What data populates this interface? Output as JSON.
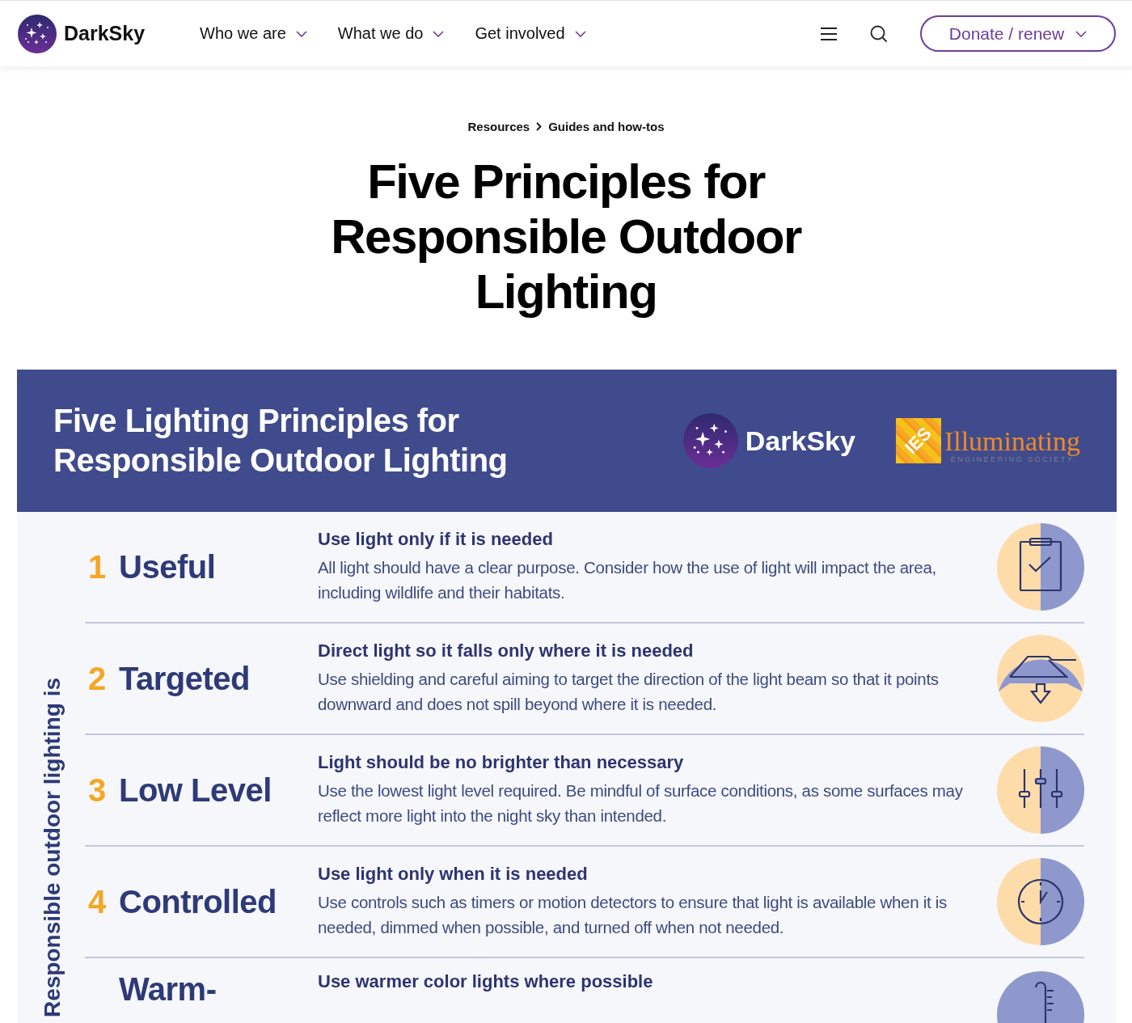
{
  "header": {
    "logo": "DarkSky",
    "nav": [
      {
        "label": "Who we are"
      },
      {
        "label": "What we do"
      },
      {
        "label": "Get involved"
      }
    ],
    "donate": "Donate / renew"
  },
  "breadcrumb": [
    "Resources",
    "Guides and how-tos"
  ],
  "title_lines": [
    "Five Principles for",
    "Responsible Outdoor",
    "Lighting"
  ],
  "banner": {
    "title_lines": [
      "Five Lighting Principles for",
      "Responsible Outdoor Lighting"
    ],
    "darksky": "DarkSky",
    "ies": {
      "mark": "IES",
      "name": "Illuminating",
      "sub": "ENGINEERING SOCIETY"
    }
  },
  "side_label": "Responsible outdoor lighting is",
  "principles": [
    {
      "number": "1",
      "name": "Useful",
      "heading": "Use light only if it is needed",
      "body": "All light should have a clear purpose. Consider how the use of light will impact the area, including wildlife and their habitats.",
      "icon": {
        "kind": "clipboard"
      }
    },
    {
      "number": "2",
      "name": "Targeted",
      "heading": "Direct light so it falls only where it is needed",
      "body": "Use shielding and careful aiming to target the direction of the light beam so that it points downward and does not spill beyond where it is needed.",
      "icon": {
        "kind": "fixture"
      }
    },
    {
      "number": "3",
      "name": "Low Level",
      "heading": "Light should be no brighter than necessary",
      "body": "Use the lowest light level required. Be mindful of surface conditions, as some surfaces may reflect more light into the night sky than intended.",
      "icon": {
        "kind": "sliders"
      }
    },
    {
      "number": "4",
      "name": "Controlled",
      "heading": "Use light only when it is needed",
      "body": "Use controls such as timers or motion detectors to ensure that light is available when it is needed, dimmed when possible, and turned off when not needed.",
      "icon": {
        "kind": "clock"
      }
    },
    {
      "name": "Warm-",
      "heading": "Use warmer color lights where possible",
      "icon": {
        "kind": "thermometer"
      }
    }
  ]
}
